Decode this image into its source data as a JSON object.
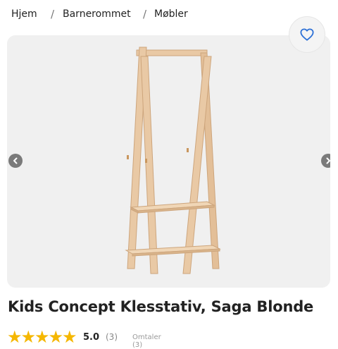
{
  "breadcrumb": {
    "items": [
      "Hjem",
      "Barnerommet",
      "Møbler"
    ],
    "separator": "/"
  },
  "product": {
    "title": "Kids Concept Klesstativ, Saga Blonde",
    "image_alt": "Kids Concept Klesstativ, Saga Blonde",
    "rating": {
      "stars": 5,
      "score": "5.0",
      "count": "(3)",
      "reviews_label": "Omtaler (3)"
    }
  },
  "icons": {
    "favorite": "heart-icon",
    "prev": "chevron-left-icon",
    "next": "chevron-right-icon",
    "star": "star-icon"
  },
  "colors": {
    "accent": "#2b6fd6",
    "star": "#f5b700",
    "gallery_bg": "#f0f0f0",
    "wood": "#e9c9a5"
  }
}
